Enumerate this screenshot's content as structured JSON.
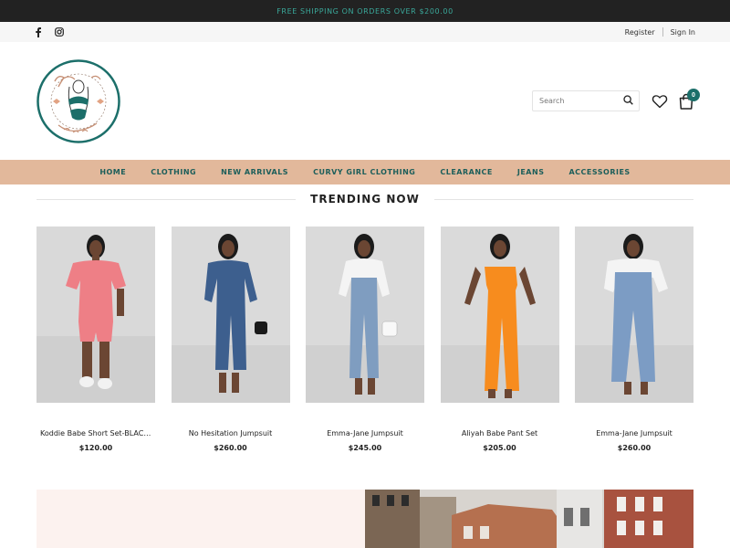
{
  "announcement": "FREE SHIPPING ON ORDERS OVER $200.00",
  "social": [
    {
      "name": "facebook-icon"
    },
    {
      "name": "instagram-icon"
    }
  ],
  "account": {
    "register": "Register",
    "sign_in": "Sign In"
  },
  "logo": {
    "alt": "A Plus by Angelina"
  },
  "search": {
    "placeholder": "Search"
  },
  "cart": {
    "count": "0"
  },
  "nav": [
    "HOME",
    "CLOTHING",
    "NEW ARRIVALS",
    "CURVY GIRL CLOTHING",
    "CLEARANCE",
    "JEANS",
    "ACCESSORIES"
  ],
  "section": {
    "title": "TRENDING NOW"
  },
  "products": [
    {
      "name": "Koddie Babe Short Set-BLACK -...",
      "price": "$120.00",
      "outfit_color": "#ee7f86"
    },
    {
      "name": "No Hesitation Jumpsuit",
      "price": "$260.00",
      "outfit_color": "#3d5f8e"
    },
    {
      "name": "Emma-Jane Jumpsuit",
      "price": "$245.00",
      "outfit_color": "#7f9dc0"
    },
    {
      "name": "Aliyah Babe Pant Set",
      "price": "$205.00",
      "outfit_color": "#f78c1e"
    },
    {
      "name": "Emma-Jane Jumpsuit",
      "price": "$260.00",
      "outfit_color": "#7c9cc4"
    }
  ],
  "colors": {
    "announce_bg": "#222222",
    "announce_text": "#3aa89a",
    "nav_bg": "#e2b89b",
    "nav_text": "#1c5e5a",
    "brand_teal": "#1c6f6a"
  }
}
